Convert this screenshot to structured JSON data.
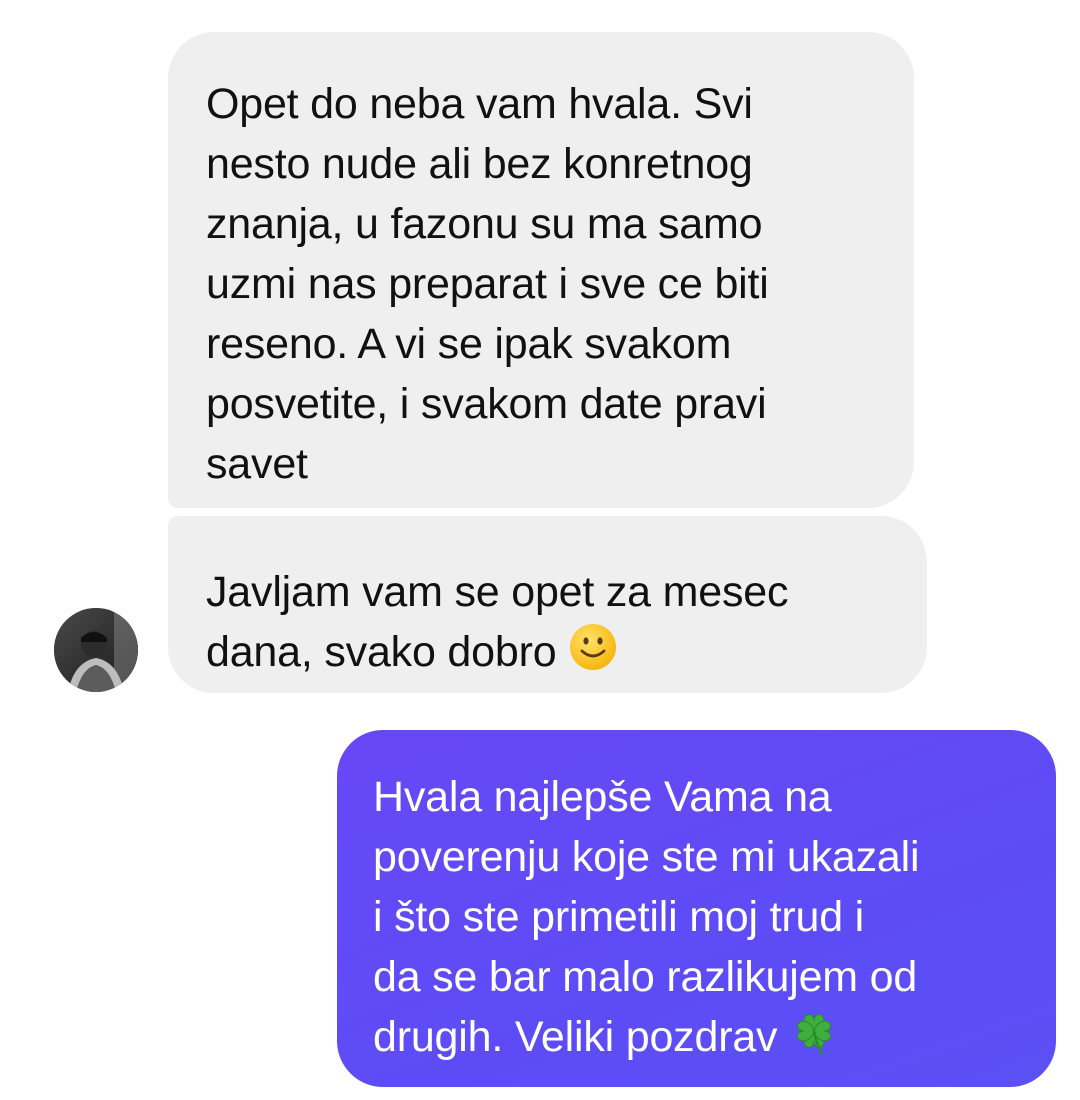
{
  "conversation": {
    "messages": [
      {
        "direction": "incoming",
        "text": "Opet do neba vam hvala. Svi\nnesto nude ali bez konretnog\nznanja, u fazonu su ma samo\nuzmi nas preparat i sve ce biti\nreseno. A vi se ipak svakom\nposvetite, i svakom date pravi\nsavet"
      },
      {
        "direction": "incoming",
        "text": "Javljam vam se opet za mesec\ndana, svako dobro",
        "trailing_emoji": "slightly-smiling-face-emoji"
      },
      {
        "direction": "outgoing",
        "text": "Hvala najlepše Vama na\npoverenju koje ste mi ukazali\ni što ste primetili moj trud i\nda se bar malo razlikujem od\ndrugih. Veliki pozdrav",
        "trailing_emoji": "four-leaf-clover-emoji"
      }
    ],
    "sender_avatar": "contact-avatar-photo"
  },
  "colors": {
    "incoming_bubble": "#efefef",
    "incoming_text": "#111111",
    "outgoing_bubble": "#5d4cf6",
    "outgoing_text": "#ffffff"
  }
}
